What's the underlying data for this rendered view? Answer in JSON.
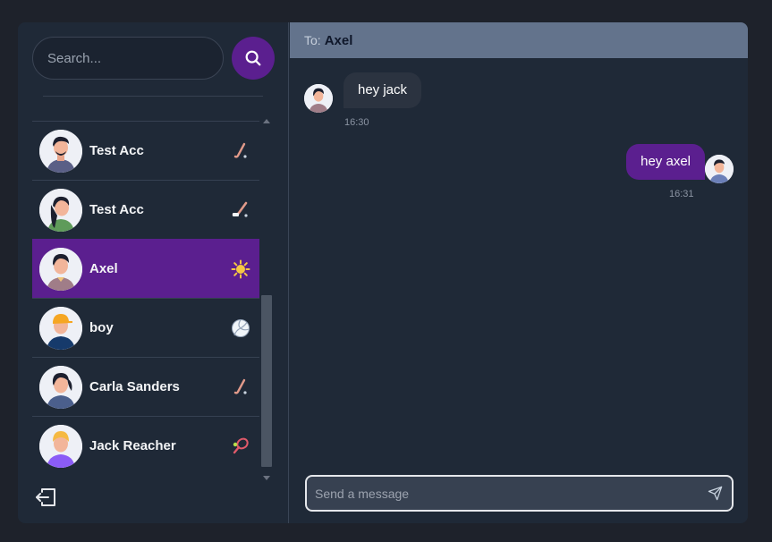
{
  "search": {
    "placeholder": "Search..."
  },
  "contacts": [
    {
      "name": "Test Acc",
      "sport": "hockey-stick-icon",
      "avatar": "man-short-hair"
    },
    {
      "name": "Test Acc",
      "sport": "hockey-stick-puck-icon",
      "avatar": "woman-long-hair"
    },
    {
      "name": "Axel",
      "sport": "sun-icon",
      "avatar": "man-dark-hair",
      "active": true
    },
    {
      "name": "boy",
      "sport": "volleyball-icon",
      "avatar": "man-orange-cap"
    },
    {
      "name": "Carla Sanders",
      "sport": "hockey-stick-icon",
      "avatar": "woman-ponytail"
    },
    {
      "name": "Jack Reacher",
      "sport": "tennis-racket-icon",
      "avatar": "man-yellow-beanie"
    }
  ],
  "chat": {
    "to_label": "To:",
    "recipient": "Axel",
    "messages": [
      {
        "direction": "in",
        "text": "hey jack",
        "time": "16:30"
      },
      {
        "direction": "out",
        "text": "hey axel",
        "time": "16:31"
      }
    ],
    "composer_placeholder": "Send a message"
  },
  "colors": {
    "accent": "#5b1f8f",
    "header": "#63738c",
    "panel": "#1f2937",
    "background": "#1e222b"
  }
}
